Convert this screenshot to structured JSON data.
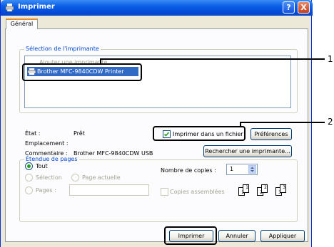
{
  "window": {
    "title": "Imprimer",
    "help_label": "?",
    "close_label": "X"
  },
  "tabs": [
    {
      "label": "Général"
    }
  ],
  "printer_selection": {
    "legend": "Sélection de l'imprimante",
    "items": [
      "Ajouter une imprimante",
      "Brother MFC-9840CDW Printer"
    ],
    "selected_index": 1
  },
  "status": {
    "etat_label": "État :",
    "etat_value": "Prêt",
    "emplacement_label": "Emplacement :",
    "emplacement_value": "",
    "commentaire_label": "Commentaire :",
    "commentaire_value": "Brother MFC-9840CDW USB"
  },
  "print_to_file": {
    "label": "Imprimer dans un fichier",
    "checked": true
  },
  "buttons": {
    "preferences": "Préférences",
    "find_printer": "Rechercher une imprimante...",
    "print": "Imprimer",
    "cancel": "Annuler",
    "apply": "Appliquer"
  },
  "page_range": {
    "legend": "Étendue de pages",
    "all": "Tout",
    "selection": "Sélection",
    "current_page": "Page actuelle",
    "pages": "Pages :"
  },
  "copies": {
    "label": "Nombre de copies :",
    "value": "1",
    "collate_label": "Copies assemblées",
    "collate_pages": [
      "1",
      "1",
      "2",
      "2",
      "3",
      "3"
    ]
  },
  "callouts": {
    "first": "1",
    "second": "2"
  },
  "colors": {
    "titlebar": "#0a5ee8",
    "selection": "#316ac5",
    "legend_text": "#0046d5"
  }
}
